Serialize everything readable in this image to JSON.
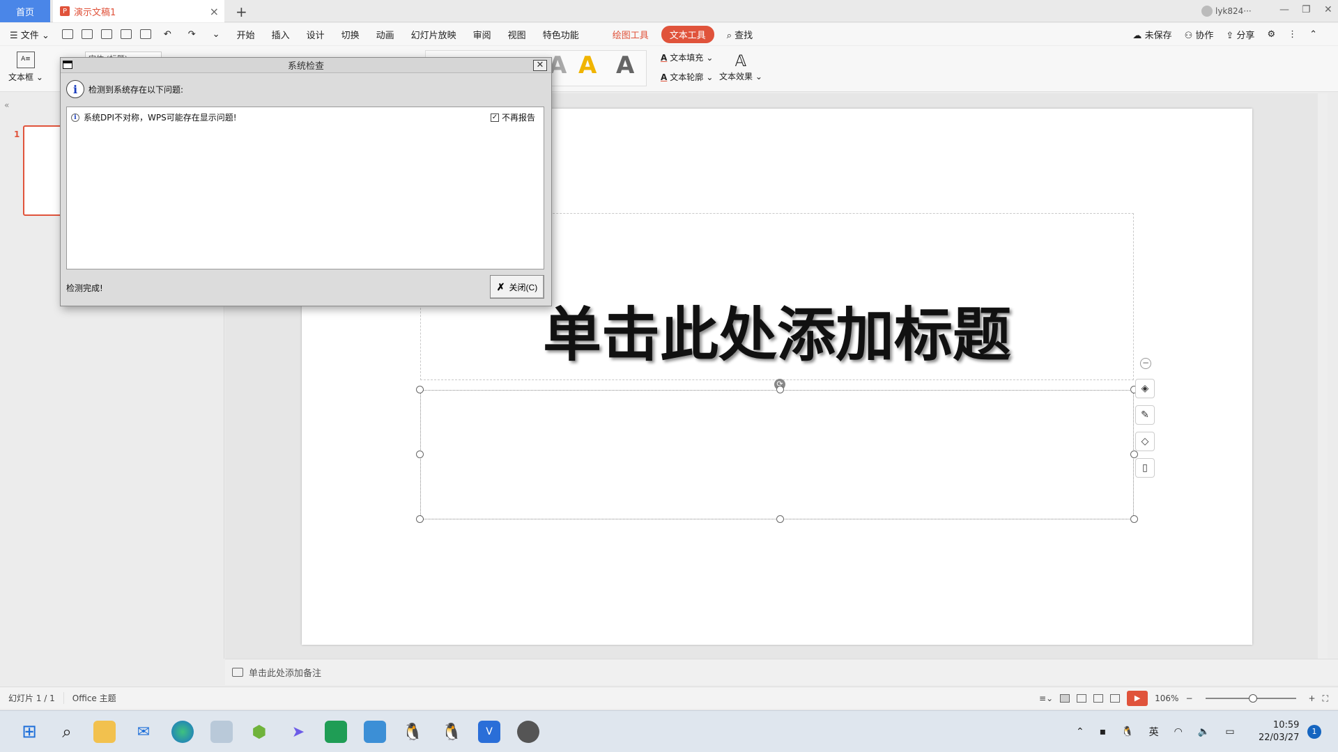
{
  "tabs": {
    "home": "首页",
    "document": "演示文稿1",
    "add": "+"
  },
  "user": {
    "name": "lyk824···"
  },
  "menu": {
    "file": "文件",
    "items": [
      "开始",
      "插入",
      "设计",
      "切换",
      "动画",
      "幻灯片放映",
      "审阅",
      "视图",
      "特色功能"
    ],
    "drawing_tools": "绘图工具",
    "text_tools": "文本工具",
    "search": "查找",
    "unsaved": "未保存",
    "collaborate": "协作",
    "share": "分享"
  },
  "ribbon": {
    "textbox": "文本框",
    "font_name": "宋体 (标题)",
    "text_fill": "文本填充",
    "text_outline": "文本轮廓",
    "text_effect": "文本效果",
    "style_letter": "A"
  },
  "slide_panel": {
    "slide_number": "1",
    "collapse": "«"
  },
  "slide": {
    "title": "单击此处添加标题"
  },
  "notes": {
    "placeholder": "单击此处添加备注"
  },
  "status": {
    "slide_info": "幻灯片 1 / 1",
    "theme": "Office 主题",
    "zoom": "106%"
  },
  "dialog": {
    "title": "系统检查",
    "header": "检测到系统存在以下问题:",
    "issue": "系统DPI不对称，WPS可能存在显示问题!",
    "dont_report": "不再报告",
    "dont_report_checked": true,
    "status": "检测完成!",
    "close_button": "关闭(C)"
  },
  "taskbar": {
    "ime": "英",
    "time": "10:59",
    "date": "22/03/27",
    "notifications": "1"
  },
  "colors": {
    "accent": "#e0533b",
    "home_tab": "#4a86e8",
    "taskbar": "#dfe6ee"
  }
}
